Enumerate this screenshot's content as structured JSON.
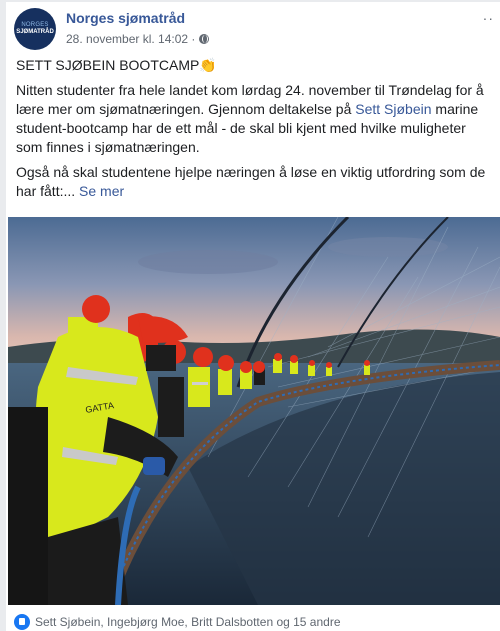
{
  "page": {
    "name": "Norges sjømatråd",
    "avatar_line1": "NORGES",
    "avatar_line2": "SJØMATRÅD",
    "timestamp": "28. november kl. 14:02 ·",
    "more_label": "··"
  },
  "post": {
    "title": "SETT SJØBEIN BOOTCAMP",
    "title_emoji": "👏",
    "p1_before": "Nitten studenter fra hele landet kom lørdag 24. november til Trøndelag for å lære mer om sjømatnæringen. Gjennom deltakelse på ",
    "p1_link": "Sett Sjøbein",
    "p1_after": " marine student-bootcamp har de ett mål - de skal bli kjent med hvilke muligheter som finnes i sjømatnæringen.",
    "p2": "Også nå skal studentene hjelpe næringen å løse en viktig utfordring som de har fått:... ",
    "see_more": "Se mer"
  },
  "image": {
    "jacket_text": "GATTA",
    "colors": {
      "helmet": "#e0311d",
      "jacket": "#d8e81c",
      "water": "#2b3d52",
      "sky_top": "#5f7fa8",
      "sky_bottom": "#d6b7b0"
    }
  },
  "reactions": {
    "text": "Sett Sjøbein, Ingebjørg Moe, Britt Dalsbotten og 15 andre"
  }
}
